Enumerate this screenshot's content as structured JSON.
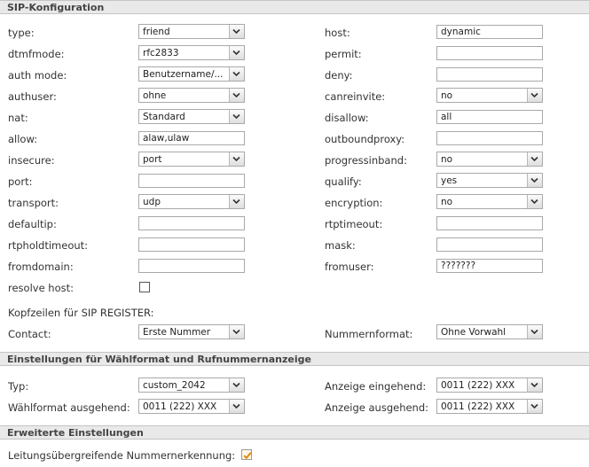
{
  "sections": {
    "sip": "SIP-Konfiguration",
    "waehl": "Einstellungen für Wählformat und Rufnummernanzeige",
    "erweitert": "Erweiterte Einstellungen"
  },
  "sip": {
    "type": {
      "label": "type:",
      "value": "friend"
    },
    "dtmfmode": {
      "label": "dtmfmode:",
      "value": "rfc2833"
    },
    "auth_mode": {
      "label": "auth mode:",
      "value": "Benutzername/..."
    },
    "authuser": {
      "label": "authuser:",
      "value": "ohne"
    },
    "nat": {
      "label": "nat:",
      "value": "Standard"
    },
    "allow": {
      "label": "allow:",
      "value": "alaw,ulaw"
    },
    "insecure": {
      "label": "insecure:",
      "value": "port"
    },
    "port": {
      "label": "port:",
      "value": ""
    },
    "transport": {
      "label": "transport:",
      "value": "udp"
    },
    "defaultip": {
      "label": "defaultip:",
      "value": ""
    },
    "rtpholdtimeout": {
      "label": "rtpholdtimeout:",
      "value": ""
    },
    "fromdomain": {
      "label": "fromdomain:",
      "value": ""
    },
    "resolve_host": {
      "label": "resolve host:",
      "checked": false
    },
    "host": {
      "label": "host:",
      "value": "dynamic"
    },
    "permit": {
      "label": "permit:",
      "value": ""
    },
    "deny": {
      "label": "deny:",
      "value": ""
    },
    "canreinvite": {
      "label": "canreinvite:",
      "value": "no"
    },
    "disallow": {
      "label": "disallow:",
      "value": "all"
    },
    "outboundproxy": {
      "label": "outboundproxy:",
      "value": ""
    },
    "progressinband": {
      "label": "progressinband:",
      "value": "no"
    },
    "qualify": {
      "label": "qualify:",
      "value": "yes"
    },
    "encryption": {
      "label": "encryption:",
      "value": "no"
    },
    "rtptimeout": {
      "label": "rtptimeout:",
      "value": ""
    },
    "mask": {
      "label": "mask:",
      "value": ""
    },
    "fromuser": {
      "label": "fromuser:",
      "value": "???????"
    },
    "kopfzeilen": "Kopfzeilen für SIP REGISTER:",
    "contact": {
      "label": "Contact:",
      "value": "Erste Nummer"
    },
    "nummernformat": {
      "label": "Nummernformat:",
      "value": "Ohne Vorwahl"
    }
  },
  "waehl": {
    "typ": {
      "label": "Typ:",
      "value": "custom_2042"
    },
    "waehlformat_ausgehend": {
      "label": "Wählformat ausgehend:",
      "value": "0011 (222) XXX"
    },
    "anzeige_eingehend": {
      "label": "Anzeige eingehend:",
      "value": "0011 (222) XXX"
    },
    "anzeige_ausgehend": {
      "label": "Anzeige ausgehend:",
      "value": "0011 (222) XXX"
    }
  },
  "erweitert": {
    "leitung": {
      "label": "Leitungsübergreifende Nummernerkennung:",
      "checked": true
    }
  },
  "icons": {
    "dropdown": "chevron-down-icon",
    "check": "checkmark-icon"
  },
  "colors": {
    "check_accent": "#e08a00",
    "header_bg": "#e9e9e9"
  }
}
